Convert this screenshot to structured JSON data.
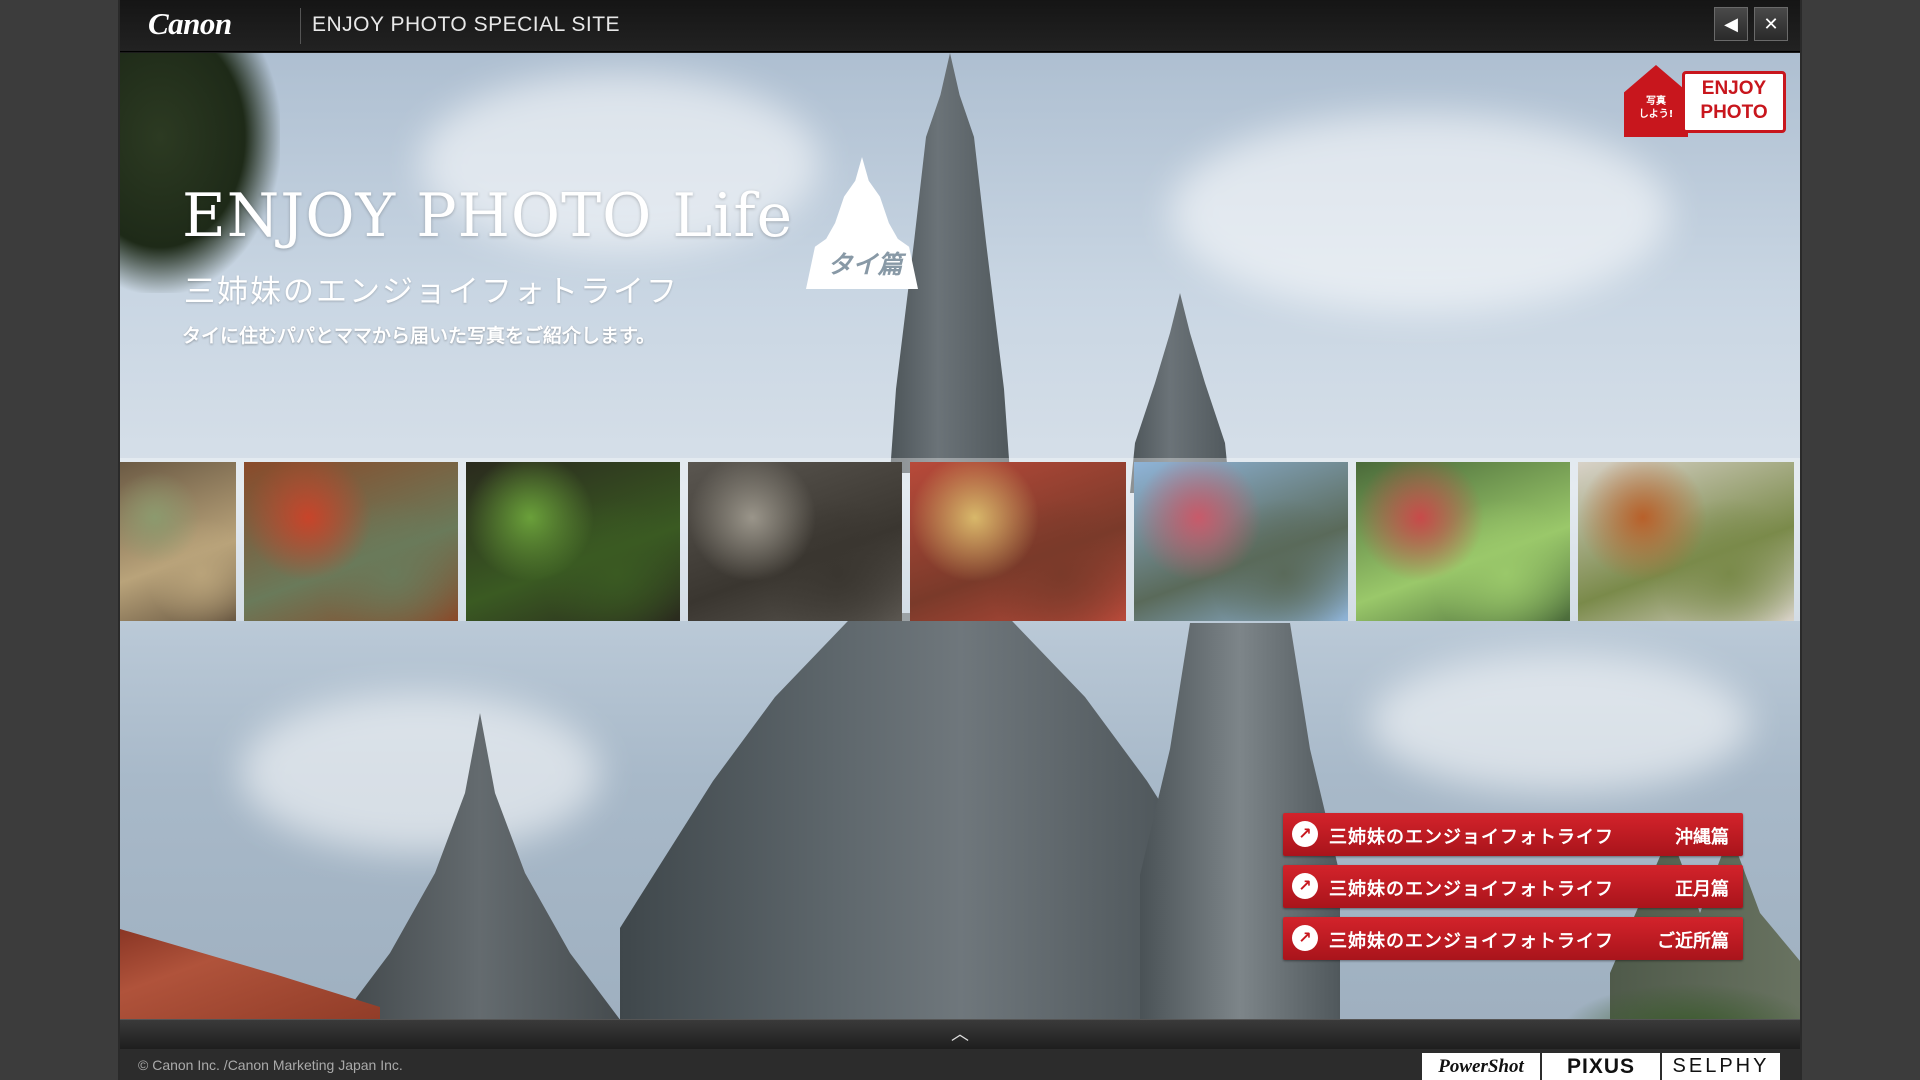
{
  "topbar": {
    "logo": "Canon",
    "site_title": "ENJOY PHOTO SPECIAL SITE",
    "sound_icon": "speaker-icon",
    "close_icon": "close-icon"
  },
  "hero": {
    "title": "ENJOY PHOTO Life",
    "badge": "タイ篇",
    "subtitle": "三姉妹のエンジョイフォトライフ",
    "tagline": "タイに住むパパとママから届いた写真をご紹介します。"
  },
  "enjoy_badge": {
    "house_text_line1": "写真",
    "house_text_line2": "しよう!",
    "label_line1": "ENJOY",
    "label_line2": "PHOTO"
  },
  "thumbnails": [
    {
      "name": "market-stalls-photo",
      "colors": [
        "#6b5a44",
        "#8c9a6e",
        "#b9a37a"
      ]
    },
    {
      "name": "red-chili-market-photo",
      "colors": [
        "#8a4a2a",
        "#c8442a",
        "#6a7a5a"
      ]
    },
    {
      "name": "green-eggplant-photo",
      "colors": [
        "#2a2a1e",
        "#6aa03a",
        "#3a5a22"
      ]
    },
    {
      "name": "covered-market-photo",
      "colors": [
        "#5a5650",
        "#9a958a",
        "#3a3630"
      ]
    },
    {
      "name": "spice-bags-photo",
      "colors": [
        "#b84a3a",
        "#d8b86a",
        "#7a3a2a"
      ]
    },
    {
      "name": "street-traffic-photo",
      "colors": [
        "#8fb4d8",
        "#c85a6a",
        "#5a6a5a"
      ]
    },
    {
      "name": "fruit-cart-photo",
      "colors": [
        "#4a6a3a",
        "#c84a4a",
        "#9ac86a"
      ]
    },
    {
      "name": "thai-dishes-photo",
      "colors": [
        "#d8d2c8",
        "#b8602a",
        "#7a8a4a"
      ]
    }
  ],
  "links": [
    {
      "left": "三姉妹のエンジョイフォトライフ",
      "right": "沖縄篇"
    },
    {
      "left": "三姉妹のエンジョイフォトライフ",
      "right": "正月篇"
    },
    {
      "left": "三姉妹のエンジョイフォトライフ",
      "right": "ご近所篇"
    }
  ],
  "footer": {
    "copyright": "© Canon Inc. /Canon Marketing Japan Inc.",
    "brands": [
      "PowerShot",
      "PIXUS",
      "SELPHY"
    ]
  },
  "colors": {
    "accent_red": "#c8161d",
    "topbar": "#1a1a1a"
  }
}
